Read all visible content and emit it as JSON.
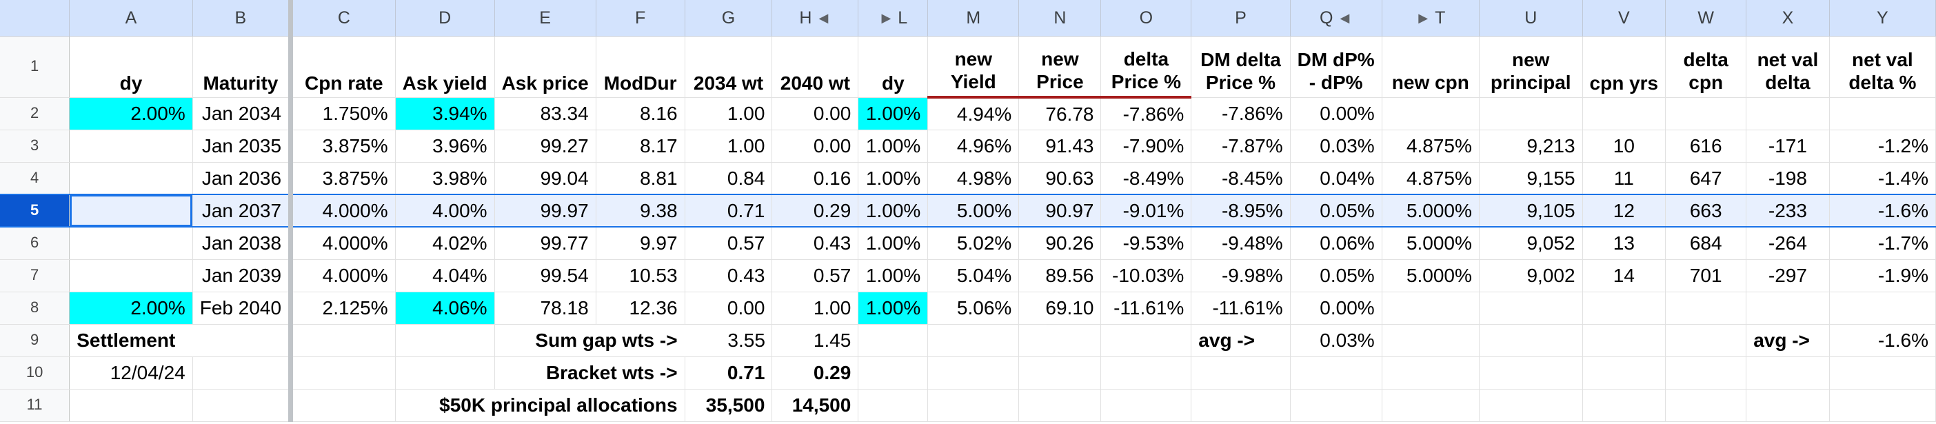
{
  "column_headers": [
    "A",
    "B",
    "C",
    "D",
    "E",
    "F",
    "G",
    "H",
    "L",
    "M",
    "N",
    "O",
    "P",
    "Q",
    "T",
    "U",
    "V",
    "W",
    "X",
    "Y"
  ],
  "row_numbers": [
    "1",
    "2",
    "3",
    "4",
    "5",
    "6",
    "7",
    "8",
    "9",
    "10",
    "11"
  ],
  "hidden_column_markers": {
    "left": "◀",
    "right": "▶"
  },
  "colors": {
    "highlight": "#00ffff",
    "header_bg": "#d3e3fd",
    "selection": "#1a73e8",
    "accent_red": "#a61c1c"
  },
  "header_row": {
    "A": "dy",
    "B": "Maturity",
    "C": "Cpn rate",
    "D": "Ask yield",
    "E": "Ask price",
    "F": "ModDur",
    "G": "2034 wt",
    "H": "2040 wt",
    "L": "dy",
    "M": "new Yield",
    "N": "new Price",
    "O": "delta Price %",
    "P": "DM delta Price %",
    "Q": "DM dP% - dP%",
    "T": "new cpn",
    "U": "new principal",
    "V": "cpn yrs",
    "W": "delta cpn",
    "X": "net val delta",
    "Y": "net val delta %"
  },
  "bond_rows": [
    {
      "A": "2.00%",
      "B": "Jan 2034",
      "C": "1.750%",
      "D": "3.94%",
      "E": "83.34",
      "F": "8.16",
      "G": "1.00",
      "H": "0.00",
      "L": "1.00%",
      "M": "4.94%",
      "N": "76.78",
      "O": "-7.86%",
      "P": "-7.86%",
      "Q": "0.00%",
      "T": "",
      "U": "",
      "V": "",
      "W": "",
      "X": "",
      "Y": ""
    },
    {
      "A": "",
      "B": "Jan 2035",
      "C": "3.875%",
      "D": "3.96%",
      "E": "99.27",
      "F": "8.17",
      "G": "1.00",
      "H": "0.00",
      "L": "1.00%",
      "M": "4.96%",
      "N": "91.43",
      "O": "-7.90%",
      "P": "-7.87%",
      "Q": "0.03%",
      "T": "4.875%",
      "U": "9,213",
      "V": "10",
      "W": "616",
      "X": "-171",
      "Y": "-1.2%"
    },
    {
      "A": "",
      "B": "Jan 2036",
      "C": "3.875%",
      "D": "3.98%",
      "E": "99.04",
      "F": "8.81",
      "G": "0.84",
      "H": "0.16",
      "L": "1.00%",
      "M": "4.98%",
      "N": "90.63",
      "O": "-8.49%",
      "P": "-8.45%",
      "Q": "0.04%",
      "T": "4.875%",
      "U": "9,155",
      "V": "11",
      "W": "647",
      "X": "-198",
      "Y": "-1.4%"
    },
    {
      "A": "",
      "B": "Jan 2037",
      "C": "4.000%",
      "D": "4.00%",
      "E": "99.97",
      "F": "9.38",
      "G": "0.71",
      "H": "0.29",
      "L": "1.00%",
      "M": "5.00%",
      "N": "90.97",
      "O": "-9.01%",
      "P": "-8.95%",
      "Q": "0.05%",
      "T": "5.000%",
      "U": "9,105",
      "V": "12",
      "W": "663",
      "X": "-233",
      "Y": "-1.6%"
    },
    {
      "A": "",
      "B": "Jan 2038",
      "C": "4.000%",
      "D": "4.02%",
      "E": "99.77",
      "F": "9.97",
      "G": "0.57",
      "H": "0.43",
      "L": "1.00%",
      "M": "5.02%",
      "N": "90.26",
      "O": "-9.53%",
      "P": "-9.48%",
      "Q": "0.06%",
      "T": "5.000%",
      "U": "9,052",
      "V": "13",
      "W": "684",
      "X": "-264",
      "Y": "-1.7%"
    },
    {
      "A": "",
      "B": "Jan 2039",
      "C": "4.000%",
      "D": "4.04%",
      "E": "99.54",
      "F": "10.53",
      "G": "0.43",
      "H": "0.57",
      "L": "1.00%",
      "M": "5.04%",
      "N": "89.56",
      "O": "-10.03%",
      "P": "-9.98%",
      "Q": "0.05%",
      "T": "5.000%",
      "U": "9,002",
      "V": "14",
      "W": "701",
      "X": "-297",
      "Y": "-1.9%"
    },
    {
      "A": "2.00%",
      "B": "Feb 2040",
      "C": "2.125%",
      "D": "4.06%",
      "E": "78.18",
      "F": "12.36",
      "G": "0.00",
      "H": "1.00",
      "L": "1.00%",
      "M": "5.06%",
      "N": "69.10",
      "O": "-11.61%",
      "P": "-11.61%",
      "Q": "0.00%",
      "T": "",
      "U": "",
      "V": "",
      "W": "",
      "X": "",
      "Y": ""
    }
  ],
  "summary": {
    "settlement_label": "Settlement",
    "settlement_date": "12/04/24",
    "sum_gap_label": "Sum gap wts ->",
    "sum_gap_g": "3.55",
    "sum_gap_h": "1.45",
    "avg_label_p": "avg ->",
    "avg_q": "0.03%",
    "avg_label_x": "avg ->",
    "avg_y": "-1.6%",
    "bracket_label": "Bracket wts ->",
    "bracket_g": "0.71",
    "bracket_h": "0.29",
    "alloc_label": "$50K principal allocations",
    "alloc_g": "35,500",
    "alloc_h": "14,500"
  }
}
